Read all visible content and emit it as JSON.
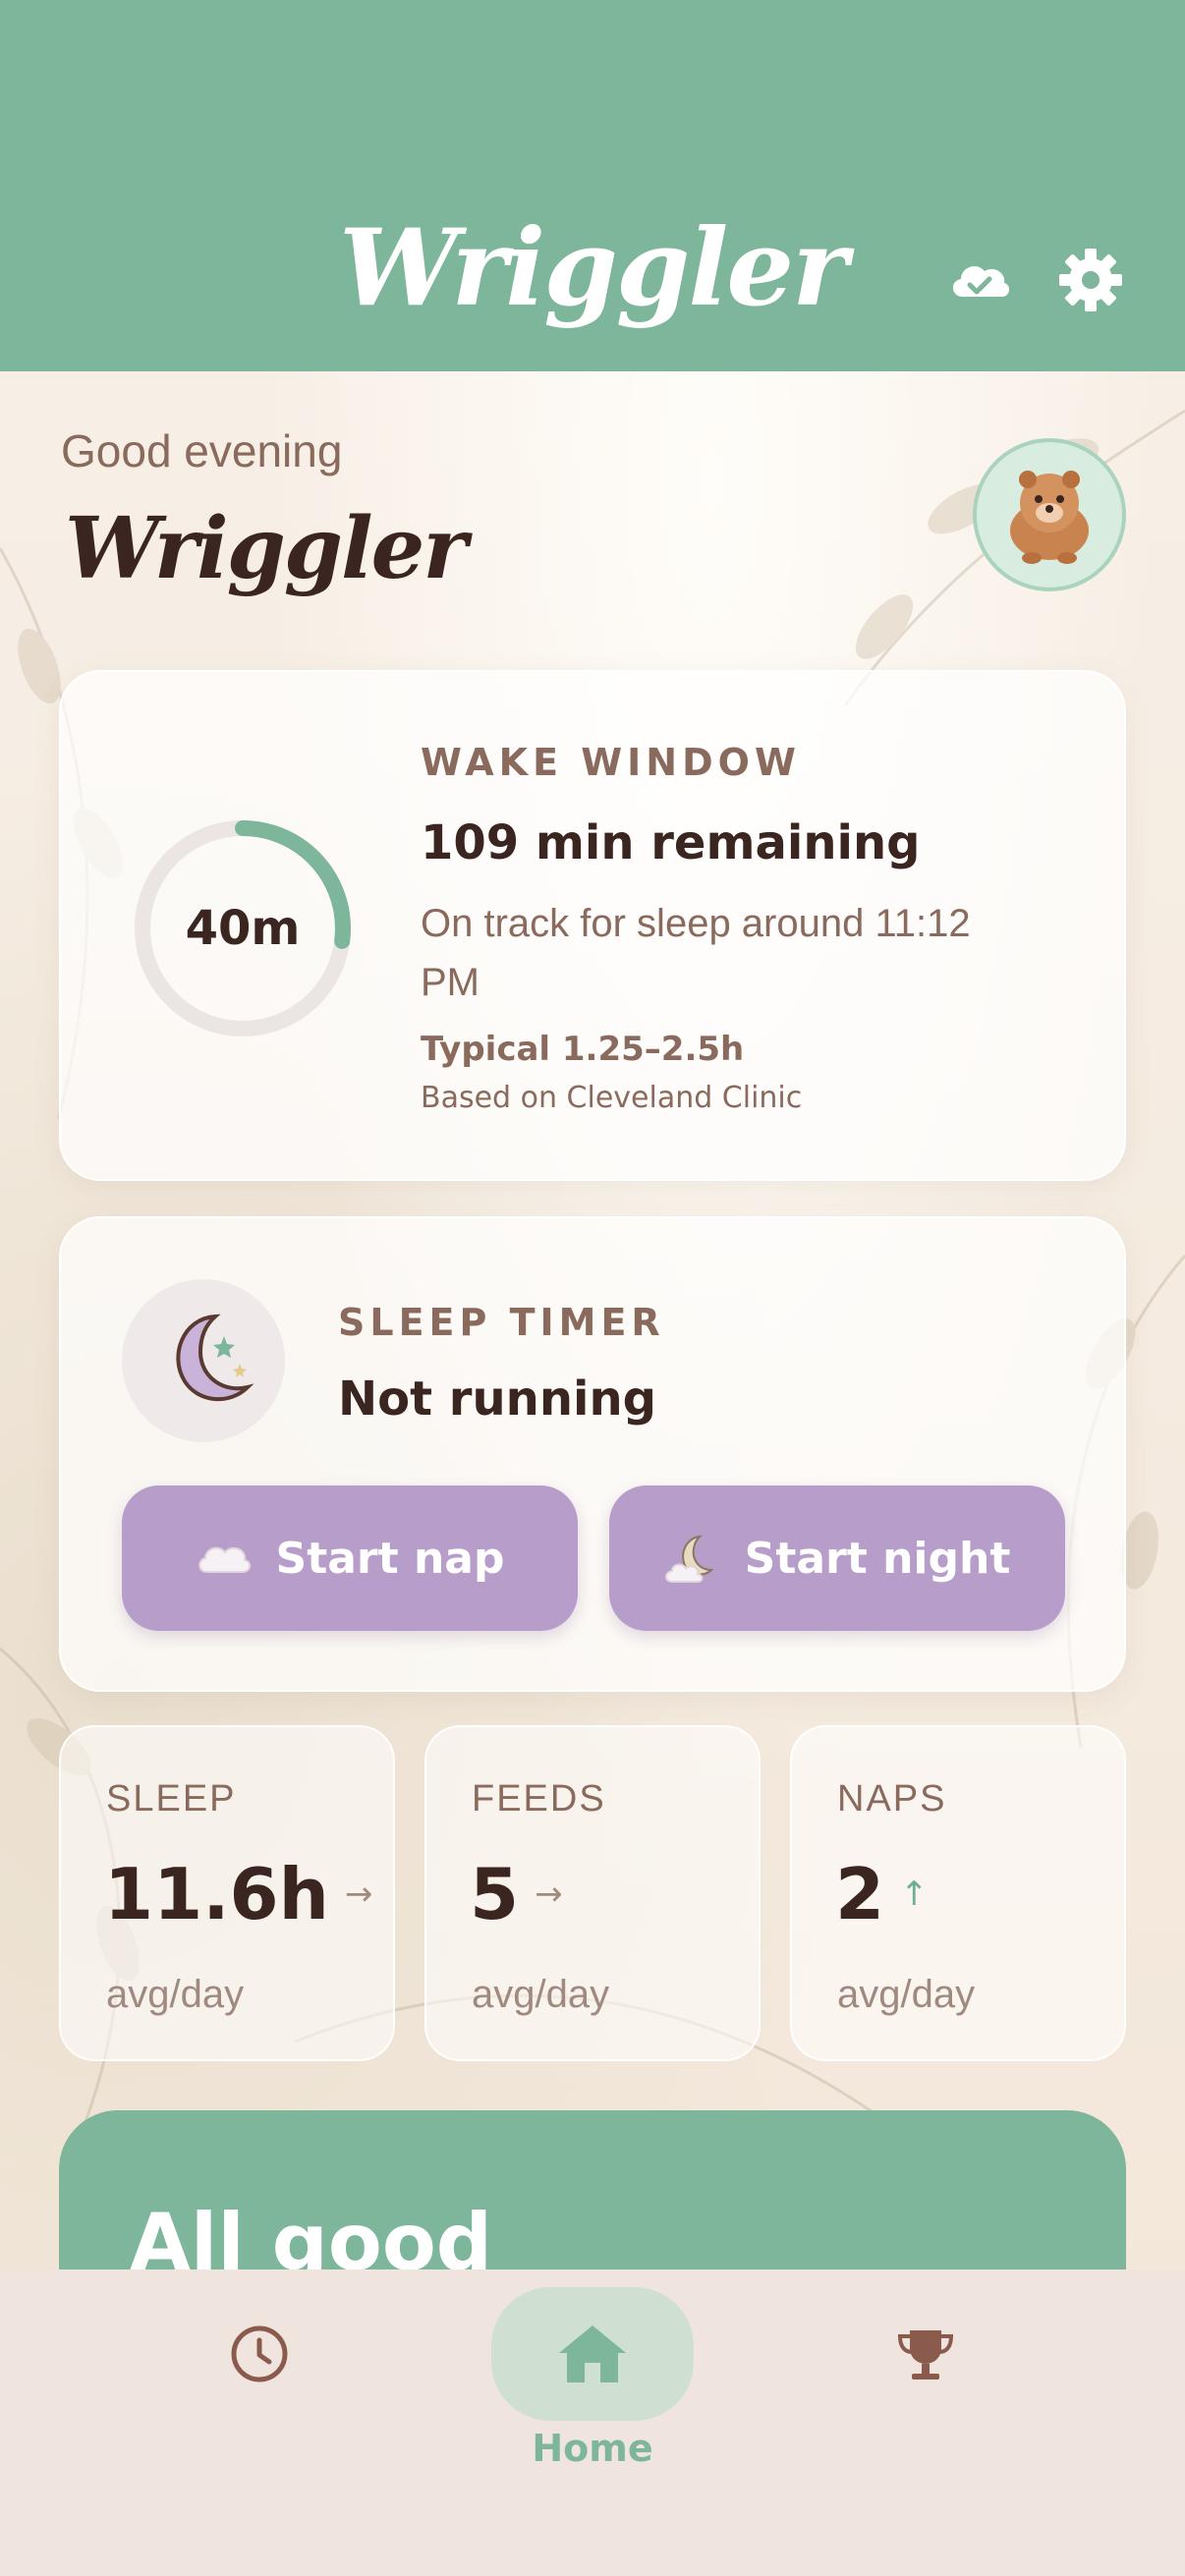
{
  "header": {
    "title": "Wriggler",
    "icons": [
      "cloud-check-icon",
      "gear-icon"
    ]
  },
  "greeting": {
    "salutation": "Good evening",
    "baby_name": "Wriggler",
    "avatar": "bear-avatar"
  },
  "wake_window": {
    "elapsed": "40m",
    "progress_fraction": 0.27,
    "title": "WAKE WINDOW",
    "remaining": "109 min remaining",
    "on_track": "On track for sleep around 11:12 PM",
    "typical": "Typical 1.25–2.5h",
    "source": "Based on Cleveland Clinic"
  },
  "sleep_timer": {
    "title": "SLEEP TIMER",
    "status": "Not running",
    "start_nap": "Start nap",
    "start_night": "Start night",
    "icon": "moon-stars-icon"
  },
  "stats": [
    {
      "label": "SLEEP",
      "value": "11.6h",
      "trend": "→",
      "sub": "avg/day"
    },
    {
      "label": "FEEDS",
      "value": "5",
      "trend": "→",
      "sub": "avg/day"
    },
    {
      "label": "NAPS",
      "value": "2",
      "trend": "↑",
      "sub": "avg/day"
    }
  ],
  "status_card": {
    "title": "All good"
  },
  "nav": {
    "home_label": "Home",
    "items": [
      "history-icon",
      "home-icon",
      "trophy-icon"
    ]
  },
  "colors": {
    "accent_green": "#7db69b",
    "button_purple": "#b79dc9",
    "text_dark": "#3b2520",
    "text_muted": "#8a6a5c"
  }
}
